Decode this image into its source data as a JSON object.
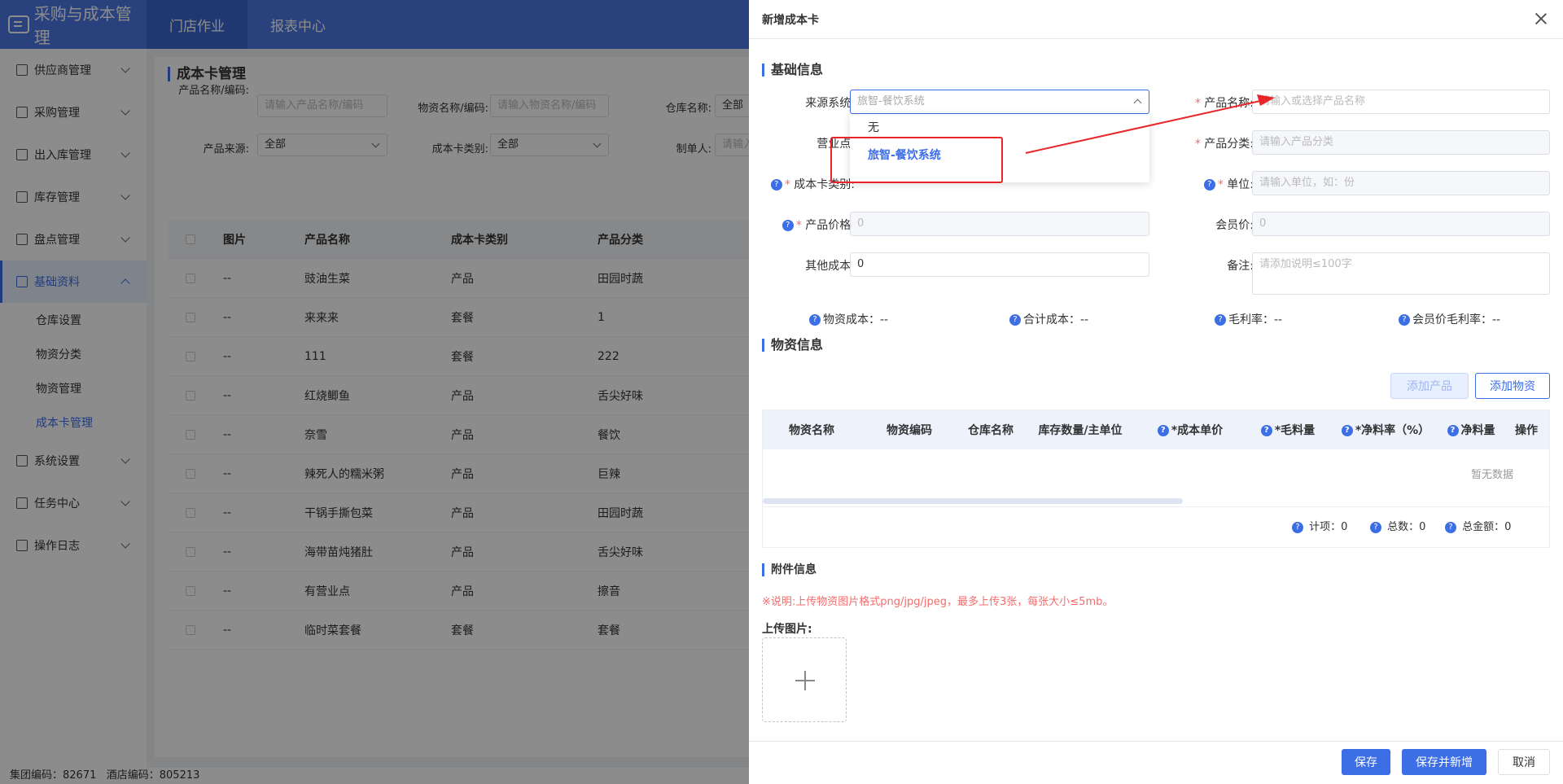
{
  "app": {
    "title": "采购与成本管理"
  },
  "topnav": [
    "门店作业",
    "报表中心"
  ],
  "sidebar": {
    "items": [
      "供应商管理",
      "采购管理",
      "出入库管理",
      "库存管理",
      "盘点管理",
      "基础资料"
    ],
    "sub_items": [
      "仓库设置",
      "物资分类",
      "物资管理",
      "成本卡管理"
    ],
    "items_after": [
      "系统设置",
      "任务中心",
      "操作日志"
    ]
  },
  "page": {
    "title": "成本卡管理",
    "filters": {
      "product_label": "产品名称/编码:",
      "product_placeholder": "请输入产品名称/编码",
      "material_label": "物资名称/编码:",
      "material_placeholder": "请输入物资名称/编码",
      "warehouse_label": "仓库名称:",
      "warehouse_value": "全部",
      "source_label": "产品来源:",
      "source_value": "全部",
      "cardtype_label": "成本卡类别:",
      "cardtype_value": "全部",
      "maker_label": "制单人:",
      "maker_placeholder": "请输入"
    },
    "table": {
      "headers": [
        "图片",
        "产品名称",
        "成本卡类别",
        "产品分类"
      ],
      "rows": [
        [
          "--",
          "豉油生菜",
          "产品",
          "田园时蔬"
        ],
        [
          "--",
          "来来来",
          "套餐",
          "1"
        ],
        [
          "--",
          "111",
          "套餐",
          "222"
        ],
        [
          "--",
          "红烧鲫鱼",
          "产品",
          "舌尖好味"
        ],
        [
          "--",
          "奈雪",
          "产品",
          "餐饮"
        ],
        [
          "--",
          "辣死人的糯米粥",
          "产品",
          "巨辣"
        ],
        [
          "--",
          "干锅手撕包菜",
          "产品",
          "田园时蔬"
        ],
        [
          "--",
          "海带苗炖猪肚",
          "产品",
          "舌尖好味"
        ],
        [
          "--",
          "有营业点",
          "产品",
          "擦音"
        ],
        [
          "--",
          "临时菜套餐",
          "套餐",
          "套餐"
        ]
      ]
    }
  },
  "footer": {
    "group_code": "集团编码：82671",
    "hotel_code": "酒店编码：805213"
  },
  "drawer": {
    "title": "新增成本卡",
    "basic_title": "基础信息",
    "source_label": "来源系统:",
    "source_value": "旅智-餐饮系统",
    "product_name_label": "产品名称:",
    "product_name_placeholder": "请输入或选择产品名称",
    "business_label": "营业点:",
    "category_label": "产品分类:",
    "category_placeholder": "请输入产品分类",
    "cardtype_label": "成本卡类别:",
    "unit_label": "单位:",
    "unit_placeholder": "请输入单位，如：份",
    "price_label": "产品价格:",
    "price_placeholder": "0",
    "member_label": "会员价:",
    "member_placeholder": "0",
    "other_label": "其他成本:",
    "other_value": "0",
    "remark_label": "备注:",
    "remark_placeholder": "请添加说明≤100字",
    "stats": [
      "物资成本：--",
      "合计成本：--",
      "毛利率：--",
      "会员价毛利率：--"
    ],
    "dropdown": [
      "无",
      "旅智-餐饮系统"
    ],
    "material_title": "物资信息",
    "add_product": "添加产品",
    "add_material": "添加物资",
    "mheaders": [
      "物资名称",
      "物资编码",
      "仓库名称",
      "库存数量/主单位",
      "*成本单价",
      "*毛料量",
      "*净料率（%）",
      "净料量",
      "操作"
    ],
    "empty": "暂无数据",
    "count": "计项：0",
    "total_qty": "总数：0",
    "total_amount": "总金额：0",
    "attach_title": "附件信息",
    "attach_note": "※说明:上传物资图片格式png/jpg/jpeg，最多上传3张，每张大小≤5mb。",
    "upload_label": "上传图片:",
    "save": "保存",
    "save_new": "保存并新增",
    "cancel": "取消"
  },
  "colors": {
    "primary": "#3c6ee6",
    "topbar": "#4b78e4",
    "annotation": "#e8262a"
  }
}
